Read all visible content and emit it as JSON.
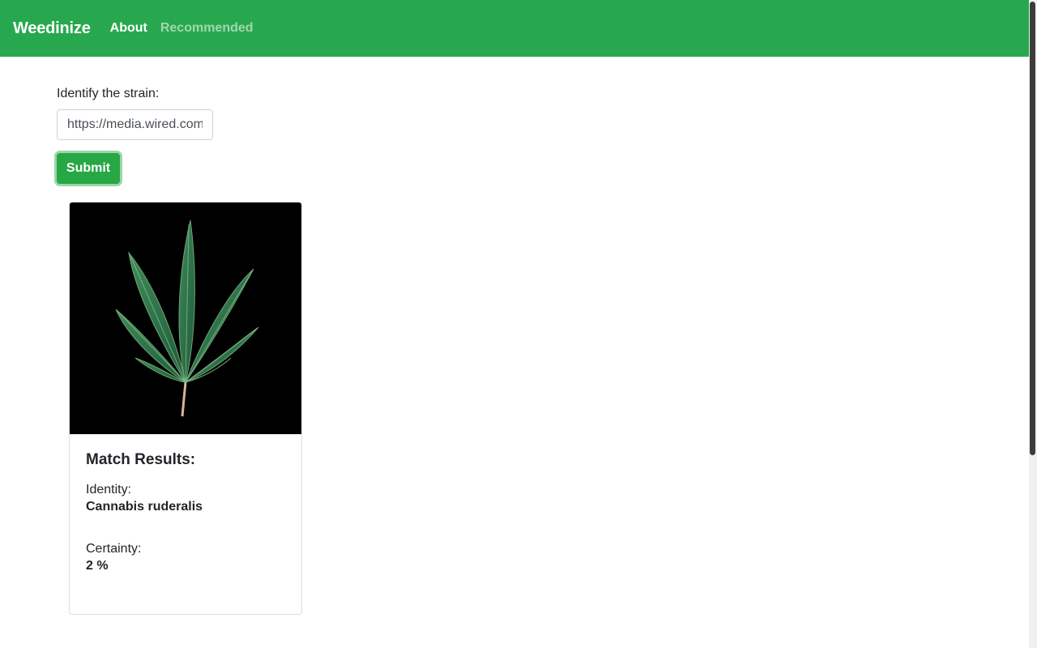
{
  "nav": {
    "brand": "Weedinize",
    "links": [
      {
        "label": "About",
        "active": true
      },
      {
        "label": "Recommended",
        "active": false
      }
    ],
    "background_color": "#28a84e"
  },
  "form": {
    "label": "Identify the strain:",
    "url_value": "https://media.wired.com",
    "submit_label": "Submit"
  },
  "result_card": {
    "image_icon": "cannabis-leaf-icon",
    "title": "Match Results:",
    "identity_label": "Identity:",
    "identity_value": "Cannabis ruderalis",
    "certainty_label": "Certainty:",
    "certainty_value": "2 %"
  }
}
